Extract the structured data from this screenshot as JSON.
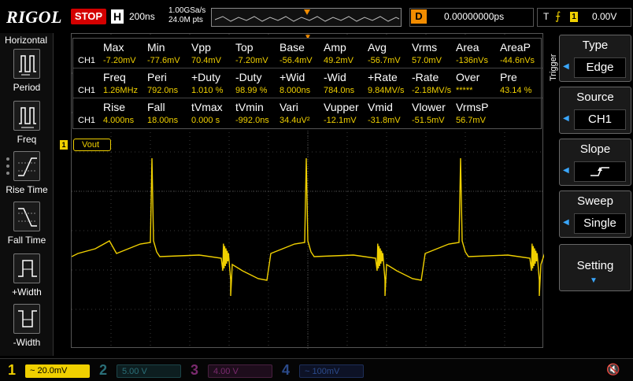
{
  "brand": "RIGOL",
  "run_state": "STOP",
  "horizontal": {
    "badge": "H",
    "timebase": "200ns",
    "sample_rate": "1.00GSa/s",
    "memory_depth": "24.0M pts"
  },
  "delay": {
    "badge": "D",
    "value": "0.00000000ps"
  },
  "trigger_status": {
    "badge": "T",
    "edge_symbol": "⨍",
    "channel": "1",
    "level": "0.00V"
  },
  "left_panel": {
    "title": "Horizontal",
    "items": [
      {
        "label": "Period",
        "icon": "period-icon"
      },
      {
        "label": "Freq",
        "icon": "frequency-icon"
      },
      {
        "label": "Rise Time",
        "icon": "rise-time-icon"
      },
      {
        "label": "Fall Time",
        "icon": "fall-time-icon"
      },
      {
        "label": "+Width",
        "icon": "positive-width-icon"
      },
      {
        "label": "-Width",
        "icon": "negative-width-icon"
      }
    ]
  },
  "measurements": {
    "rows": [
      {
        "channel": "CH1",
        "headers": [
          "Max",
          "Min",
          "Vpp",
          "Top",
          "Base",
          "Amp",
          "Avg",
          "Vrms",
          "Area",
          "AreaP"
        ],
        "values": [
          "-7.20mV",
          "-77.6mV",
          "70.4mV",
          "-7.20mV",
          "-56.4mV",
          "49.2mV",
          "-56.7mV",
          "57.0mV",
          "-136nVs",
          "-44.6nVs"
        ]
      },
      {
        "channel": "CH1",
        "headers": [
          "Freq",
          "Peri",
          "+Duty",
          "-Duty",
          "+Wid",
          "-Wid",
          "+Rate",
          "-Rate",
          "Over",
          "Pre"
        ],
        "values": [
          "1.26MHz",
          "792.0ns",
          "1.010 %",
          "98.99 %",
          "8.000ns",
          "784.0ns",
          "9.84MV/s",
          "-2.18MV/s",
          "*****",
          "43.14 %"
        ]
      },
      {
        "channel": "CH1",
        "headers": [
          "Rise",
          "Fall",
          "tVmax",
          "tVmin",
          "Vari",
          "Vupper",
          "Vmid",
          "Vlower",
          "VrmsP"
        ],
        "values": [
          "4.000ns",
          "18.00ns",
          "0.000 s",
          "-992.0ns",
          "34.4uV²",
          "-12.1mV",
          "-31.8mV",
          "-51.5mV",
          "56.7mV"
        ]
      }
    ]
  },
  "channel_label": {
    "number": "1",
    "name": "Vout"
  },
  "trigger_menu": {
    "side_label": "Trigger",
    "type": {
      "title": "Type",
      "value": "Edge"
    },
    "source": {
      "title": "Source",
      "value": "CH1"
    },
    "slope": {
      "title": "Slope",
      "value_icon": "rising-edge-icon"
    },
    "sweep": {
      "title": "Sweep",
      "value": "Single"
    },
    "setting": {
      "title": "Setting"
    }
  },
  "channels": [
    {
      "number": "1",
      "scale": "20.0mV",
      "color": "#f0d000",
      "active": true
    },
    {
      "number": "2",
      "scale": "5.00 V",
      "color": "#2fb8c8",
      "active": false
    },
    {
      "number": "3",
      "scale": "4.00 V",
      "color": "#c83cb4",
      "active": false
    },
    {
      "number": "4",
      "scale": "100mV",
      "color": "#2b5fd8",
      "active": false
    }
  ],
  "colors": {
    "ch1": "#f0d000",
    "stop": "#d40000",
    "delay_badge": "#f28c00",
    "accent": "#3aa7ff"
  }
}
